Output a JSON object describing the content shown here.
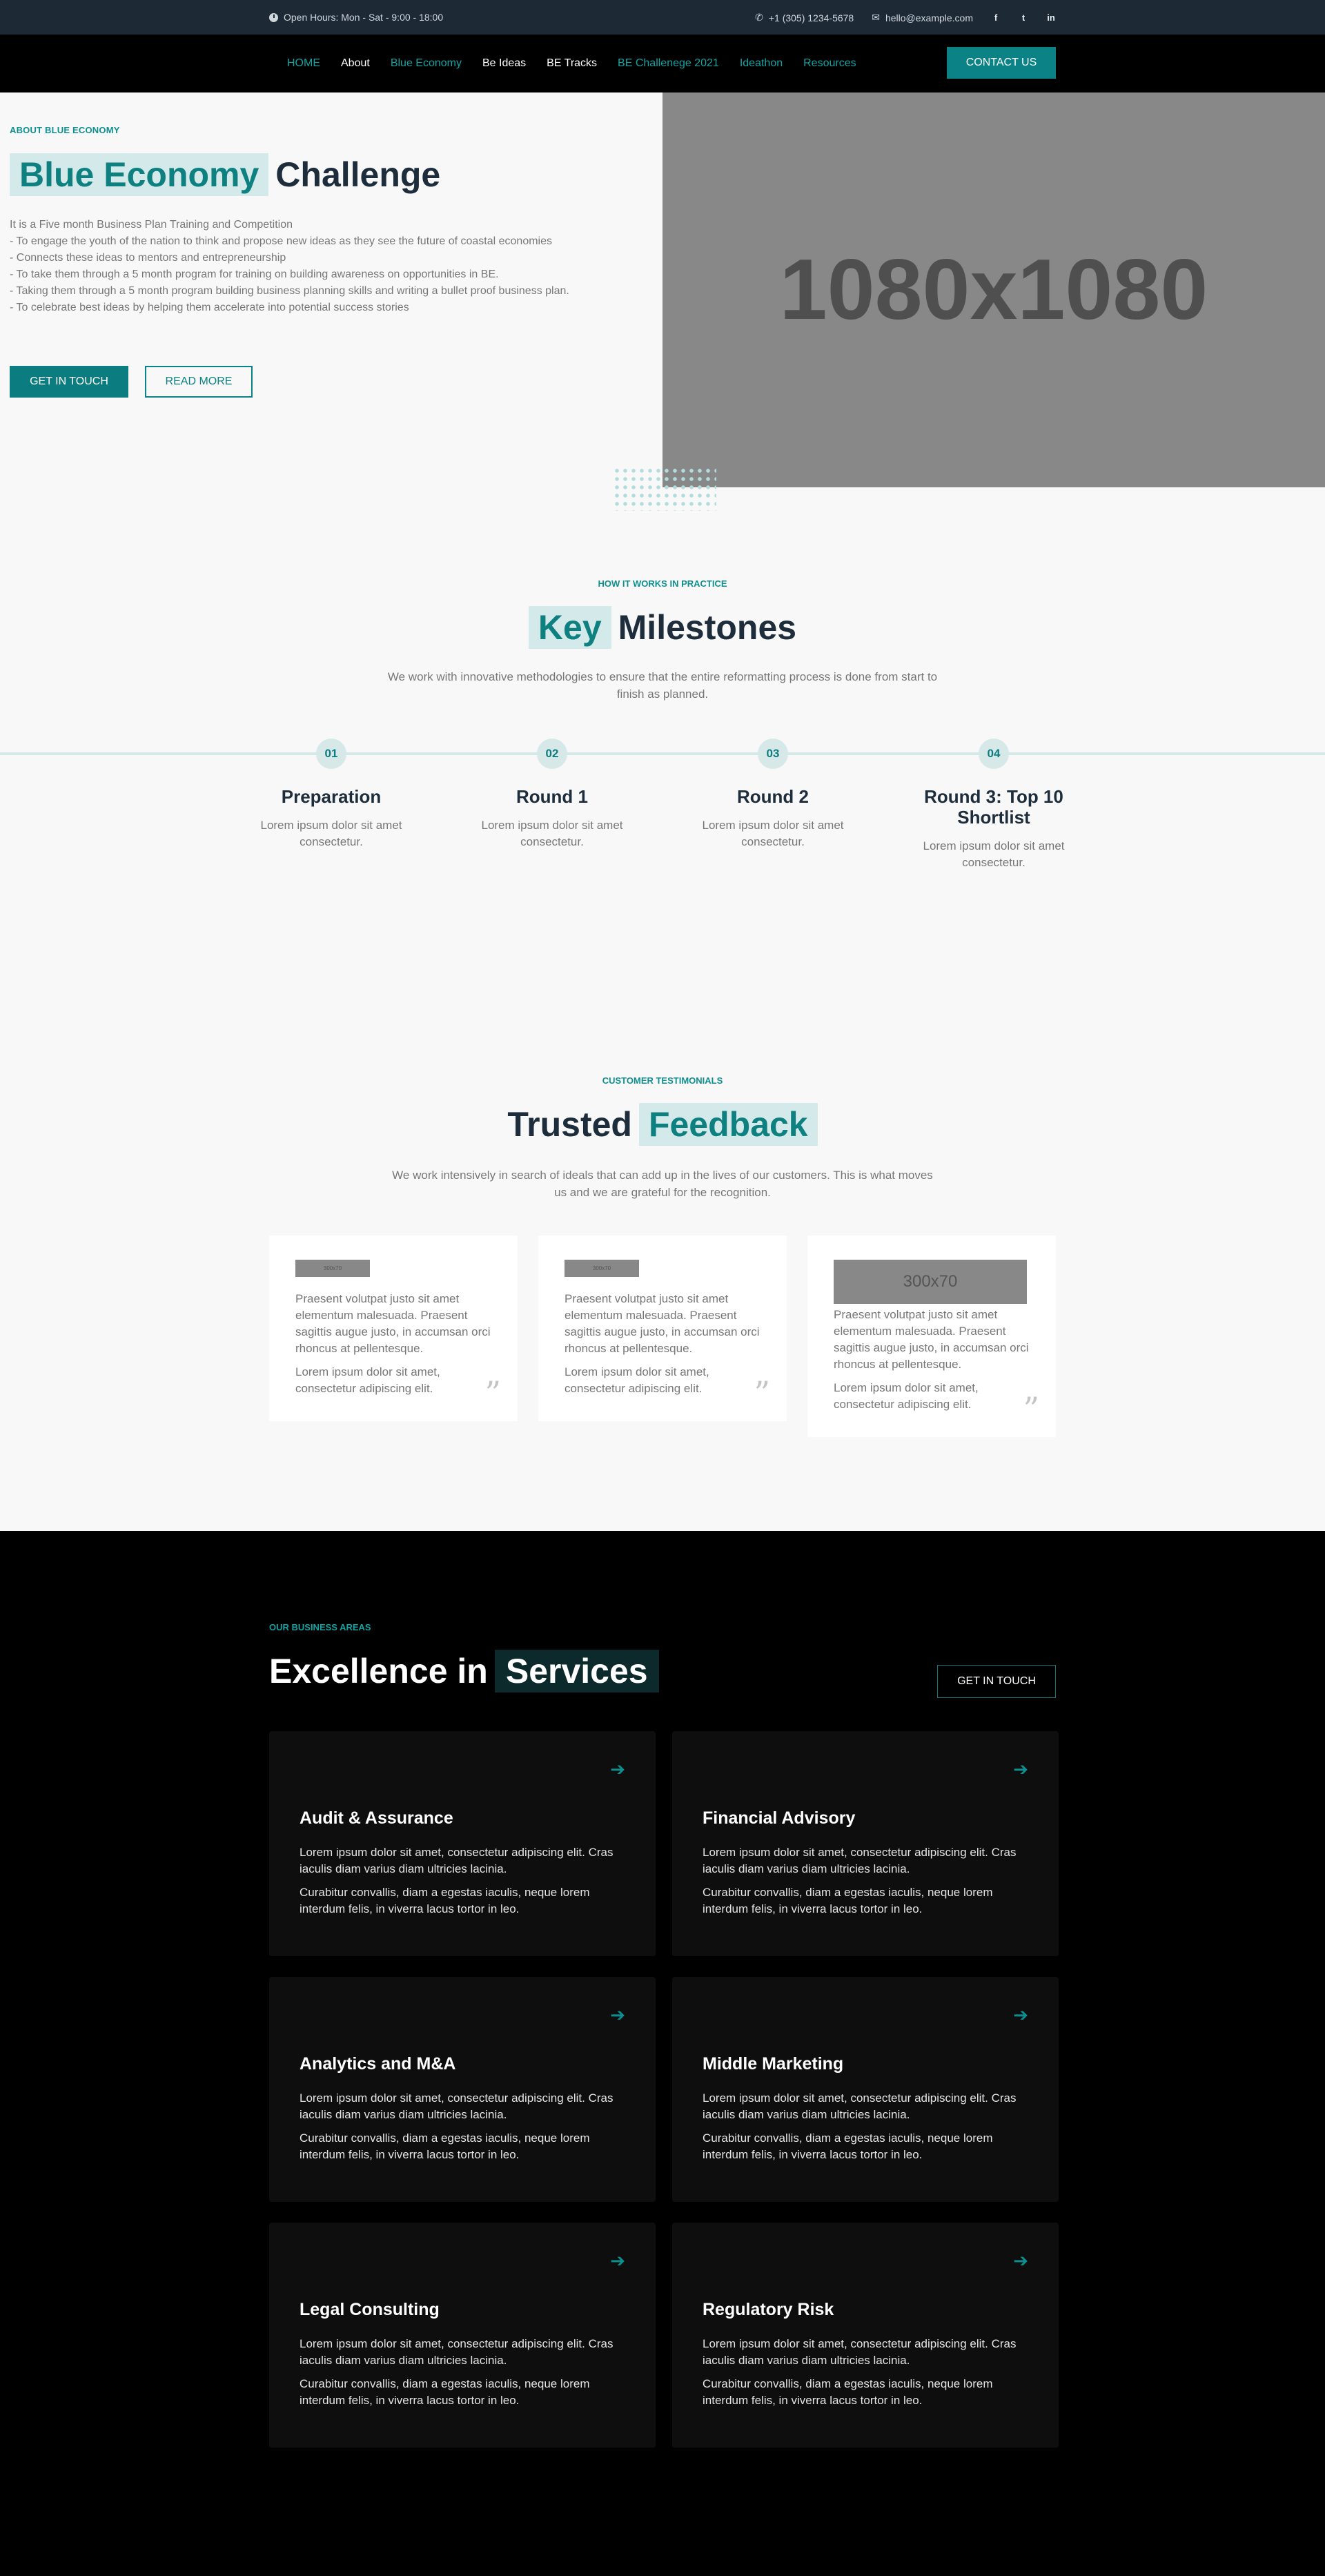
{
  "topbar": {
    "hours": "Open Hours: Mon - Sat - 9:00 - 18:00",
    "phone": "+1 (305) 1234-5678",
    "email": "hello@example.com",
    "social": [
      "f",
      "t",
      "in"
    ]
  },
  "nav": {
    "items": [
      "HOME",
      "About",
      "Blue Economy",
      "Be Ideas",
      "BE Tracks",
      "BE Challenege 2021",
      "Ideathon",
      "Resources"
    ],
    "cta": "CONTACT US"
  },
  "hero": {
    "eyebrow": "ABOUT BLUE ECONOMY",
    "title_highlight": "Blue Economy",
    "title_rest": "Challenge",
    "text": "It is a Five month Business Plan Training and Competition\n- To engage the youth of the nation to think and propose new ideas as they see the future of coastal economies\n- Connects these ideas to mentors and  entrepreneurship\n- To take them through a 5 month program for training on building awareness on opportunities in BE.\n- Taking them through a 5 month program building business planning skills and writing a bullet proof business plan.\n- To celebrate best ideas by helping them accelerate into potential success stories",
    "btn_primary": "GET IN TOUCH",
    "btn_secondary": "READ MORE",
    "image_placeholder": "1080x1080"
  },
  "milestones": {
    "eyebrow": "HOW IT WORKS IN PRACTICE",
    "title_highlight": "Key",
    "title_rest": "Milestones",
    "subtitle": "We work with innovative methodologies to ensure that the entire reformatting process is done from start to finish as planned.",
    "items": [
      {
        "num": "01",
        "title": "Preparation",
        "desc": "Lorem ipsum dolor sit amet consectetur."
      },
      {
        "num": "02",
        "title": "Round 1",
        "desc": "Lorem ipsum dolor sit amet consectetur."
      },
      {
        "num": "03",
        "title": "Round 2",
        "desc": "Lorem ipsum dolor sit amet consectetur."
      },
      {
        "num": "04",
        "title": "Round 3: Top 10 Shortlist",
        "desc": "Lorem ipsum dolor sit amet consectetur."
      }
    ]
  },
  "testimonials": {
    "eyebrow": "CUSTOMER TESTIMONIALS",
    "title_rest": "Trusted",
    "title_highlight": "Feedback",
    "subtitle": "We work intensively in search of ideals that can add up in the lives of our customers. This is what moves us and we are grateful for the recognition.",
    "cards": [
      {
        "logo": "300x70",
        "p1": "Praesent volutpat justo sit amet elementum malesuada. Praesent sagittis augue justo, in accumsan orci rhoncus at pellentesque.",
        "p2": "Lorem ipsum dolor sit amet, consectetur adipiscing elit."
      },
      {
        "logo": "300x70",
        "p1": "Praesent volutpat justo sit amet elementum malesuada. Praesent sagittis augue justo, in accumsan orci rhoncus at pellentesque.",
        "p2": "Lorem ipsum dolor sit amet, consectetur adipiscing elit."
      },
      {
        "logo": "300x70",
        "p1": "Praesent volutpat justo sit amet elementum malesuada. Praesent sagittis augue justo, in accumsan orci rhoncus at pellentesque.",
        "p2": "Lorem ipsum dolor sit amet, consectetur adipiscing elit."
      }
    ]
  },
  "services": {
    "eyebrow": "OUR BUSINESS AREAS",
    "title_rest": "Excellence in",
    "title_highlight": "Services",
    "cta": "GET IN TOUCH",
    "cards": [
      {
        "title": "Audit & Assurance",
        "p1": "Lorem ipsum dolor sit amet, consectetur adipiscing elit. Cras iaculis diam varius diam ultricies lacinia.",
        "p2": "Curabitur convallis, diam a egestas iaculis, neque lorem interdum felis, in viverra lacus tortor in leo."
      },
      {
        "title": "Financial Advisory",
        "p1": "Lorem ipsum dolor sit amet, consectetur adipiscing elit. Cras iaculis diam varius diam ultricies lacinia.",
        "p2": "Curabitur convallis, diam a egestas iaculis, neque lorem interdum felis, in viverra lacus tortor in leo."
      },
      {
        "title": "Analytics and M&A",
        "p1": "Lorem ipsum dolor sit amet, consectetur adipiscing elit. Cras iaculis diam varius diam ultricies lacinia.",
        "p2": "Curabitur convallis, diam a egestas iaculis, neque lorem interdum felis, in viverra lacus tortor in leo."
      },
      {
        "title": "Middle Marketing",
        "p1": "Lorem ipsum dolor sit amet, consectetur adipiscing elit. Cras iaculis diam varius diam ultricies lacinia.",
        "p2": "Curabitur convallis, diam a egestas iaculis, neque lorem interdum felis, in viverra lacus tortor in leo."
      },
      {
        "title": "Legal Consulting",
        "p1": "Lorem ipsum dolor sit amet, consectetur adipiscing elit. Cras iaculis diam varius diam ultricies lacinia.",
        "p2": "Curabitur convallis, diam a egestas iaculis, neque lorem interdum felis, in viverra lacus tortor in leo."
      },
      {
        "title": "Regulatory Risk",
        "p1": "Lorem ipsum dolor sit amet, consectetur adipiscing elit. Cras iaculis diam varius diam ultricies lacinia.",
        "p2": "Curabitur convallis, diam a egestas iaculis, neque lorem interdum felis, in viverra lacus tortor in leo."
      }
    ]
  },
  "colors": {
    "accent": "#0b8286",
    "dark": "#1d2a36",
    "highlight": "#d4e9ea"
  }
}
